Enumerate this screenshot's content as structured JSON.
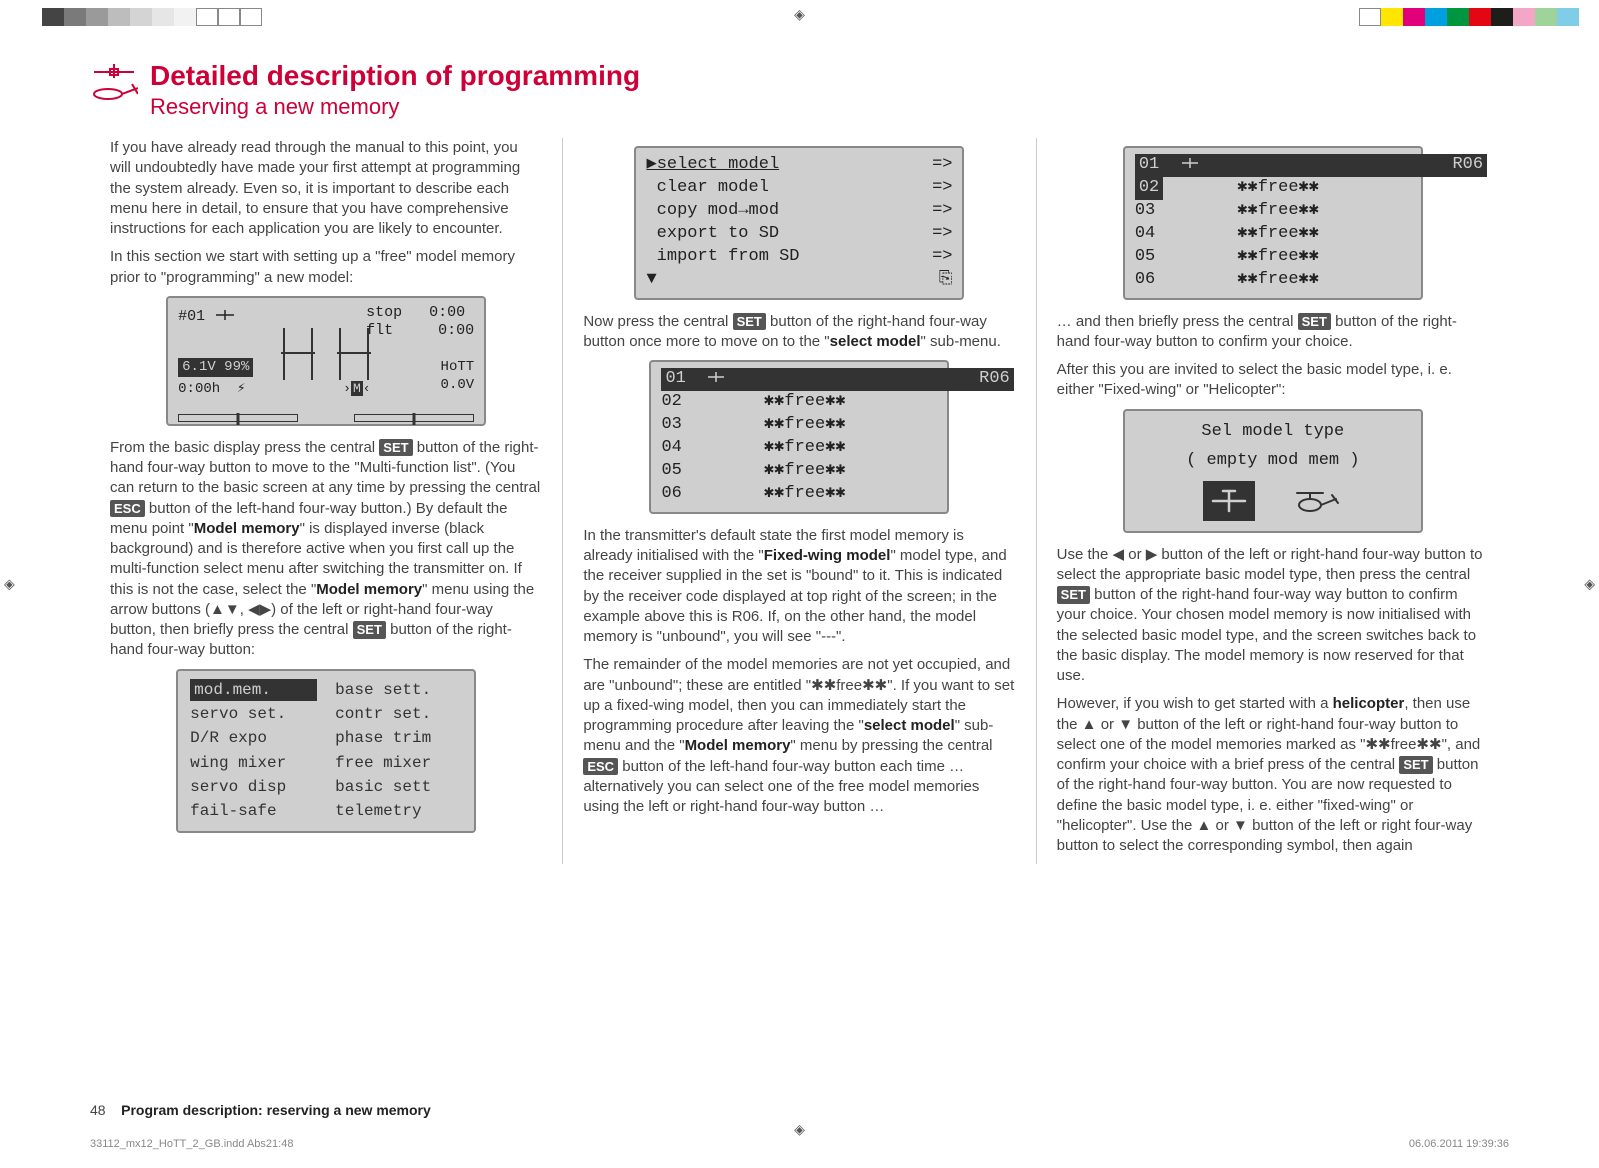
{
  "header": {
    "title": "Detailed description of programming",
    "subtitle": "Reserving a new memory"
  },
  "badges": {
    "set": "SET",
    "esc": "ESC"
  },
  "col1": {
    "p1": "If you have already read through the manual to this point, you will undoubtedly have made your first attempt at programming the system already. Even so, it is important to describe each menu here in detail, to ensure that you have comprehensive instructions for each application you are likely to encounter.",
    "p2": "In this section we start with setting up a \"free\" model memory prior to \"programming\" a new model:",
    "basic_display": {
      "slot": "#01",
      "stop_lbl": "stop",
      "stop_val": "0:00",
      "flt_lbl": "flt",
      "flt_val": "0:00",
      "batt": "6.1V  99%",
      "time": "0:00h",
      "hott": "HoTT",
      "volt": "0.0V",
      "m": "M"
    },
    "p3a": "From the basic display press the central ",
    "p3b": " button of the right-hand four-way button to move to the \"Multi-function list\". (You can return to the basic screen at any time by pressing the central ",
    "p3c": " button of the left-hand four-way button.) By default the menu point \"",
    "p3_bold1": "Model memory",
    "p3d": "\" is displayed inverse (black background) and is therefore active when you first call up the multi-function select menu after switching the transmitter on. If this is not the case, select the \"",
    "p3_bold2": "Model memory",
    "p3e": "\" menu using the arrow buttons (▲▼, ◀▶) of the left or right-hand four-way button, then briefly press the central ",
    "p3f": " button of the right-hand four-way button:",
    "menu_items": [
      [
        "mod.mem.",
        "base sett."
      ],
      [
        "servo set.",
        "contr set."
      ],
      [
        "D/R expo",
        "phase trim"
      ],
      [
        "wing mixer",
        "free mixer"
      ],
      [
        "servo disp",
        "basic sett"
      ],
      [
        "fail-safe",
        "telemetry"
      ]
    ]
  },
  "col2": {
    "menu1": [
      [
        "▶select model",
        "=>"
      ],
      [
        " clear model",
        "=>"
      ],
      [
        " copy mod→mod",
        "=>"
      ],
      [
        " export to SD",
        "=>"
      ],
      [
        " import from SD",
        "=>"
      ]
    ],
    "menu1_footer_left": "▼",
    "menu1_footer_right": "⎘",
    "p1a": "Now press the central ",
    "p1b": " button of the right-hand four-way button once more to move on to the \"",
    "p1_bold": "select model",
    "p1c": "\" sub-menu.",
    "list": {
      "header_num": "01",
      "header_rx": "R06",
      "rows": [
        [
          "02",
          "✱✱free✱✱"
        ],
        [
          "03",
          "✱✱free✱✱"
        ],
        [
          "04",
          "✱✱free✱✱"
        ],
        [
          "05",
          "✱✱free✱✱"
        ],
        [
          "06",
          "✱✱free✱✱"
        ]
      ]
    },
    "p2a": "In the transmitter's default state the first model memory is already initialised with the \"",
    "p2_bold1": "Fixed-wing model",
    "p2b": "\" model type, and the receiver supplied in the set is \"bound\" to it. This is indicated by the receiver code displayed at top right of the screen; in the example above this is R06. If, on the other hand, the model memory is \"unbound\", you will see \"---\".",
    "p3": "The remainder of the model memories are not yet occupied, and are \"unbound\"; these are entitled \"✱✱free✱✱\". If you want to set up a fixed-wing model, then you can immediately start the programming procedure after leaving the \"",
    "p3_bold1": "select model",
    "p3b": "\" sub-menu and the \"",
    "p3_bold2": "Model memory",
    "p3c": "\" menu by pressing the central ",
    "p3d": " button of the left-hand four-way button each time … alternatively you can select one of the free model memories using the left or right-hand four-way button …"
  },
  "col3": {
    "list": {
      "header_num": "01",
      "header_rx": "R06",
      "rows": [
        [
          "02",
          "✱✱free✱✱"
        ],
        [
          "03",
          "✱✱free✱✱"
        ],
        [
          "04",
          "✱✱free✱✱"
        ],
        [
          "05",
          "✱✱free✱✱"
        ],
        [
          "06",
          "✱✱free✱✱"
        ]
      ]
    },
    "p1a": "… and then briefly press the central ",
    "p1b": " button of the right-hand four-way button to confirm your choice.",
    "p2": "After this you are invited to select the basic model type, i. e. either \"Fixed-wing\" or \"Helicopter\":",
    "type_screen": {
      "line1": "Sel model type",
      "line2": "( empty mod mem )"
    },
    "p3a": "Use the ◀ or ▶ button of the left or right-hand four-way button to select the appropriate basic model type, then press the central ",
    "p3b": " button of the right-hand four-way way button to confirm your choice. Your chosen model memory is now initialised with the selected basic model type, and the screen switches back to the basic display. The model memory is now reserved for that use.",
    "p4a": "However, if you wish to get started with a ",
    "p4_bold1": "helicopter",
    "p4b": ", then use the ▲ or ▼ button of the left or right-hand four-way button to select one of the model memories marked as \"✱✱free✱✱\", and confirm your choice with a brief press of the central ",
    "p4c": " button of the right-hand four-way button. You are now requested to define the basic model type, i. e. either \"fixed-wing\" or \"helicopter\". Use the ▲ or ▼ button of the left or right four-way button to select the corresponding symbol, then again"
  },
  "footer": {
    "page": "48",
    "title": "Program description: reserving a new memory"
  },
  "print": {
    "file": "33112_mx12_HoTT_2_GB.indd   Abs21:48",
    "date": "06.06.2011   19:39:36"
  },
  "swatches_left": [
    "#fff",
    "#444",
    "#7a7a7a",
    "#9a9a9a",
    "#bdbdbd",
    "#d4d4d4",
    "#e6e6e6",
    "#f2f2f2",
    "",
    "",
    ""
  ],
  "swatches_right": [
    "",
    "#ffe600",
    "#e2007a",
    "#00a0e0",
    "#009640",
    "#e30613",
    "#1d1d1b",
    "#f3a6c5",
    "#a0d39b",
    "#7fcde6"
  ]
}
